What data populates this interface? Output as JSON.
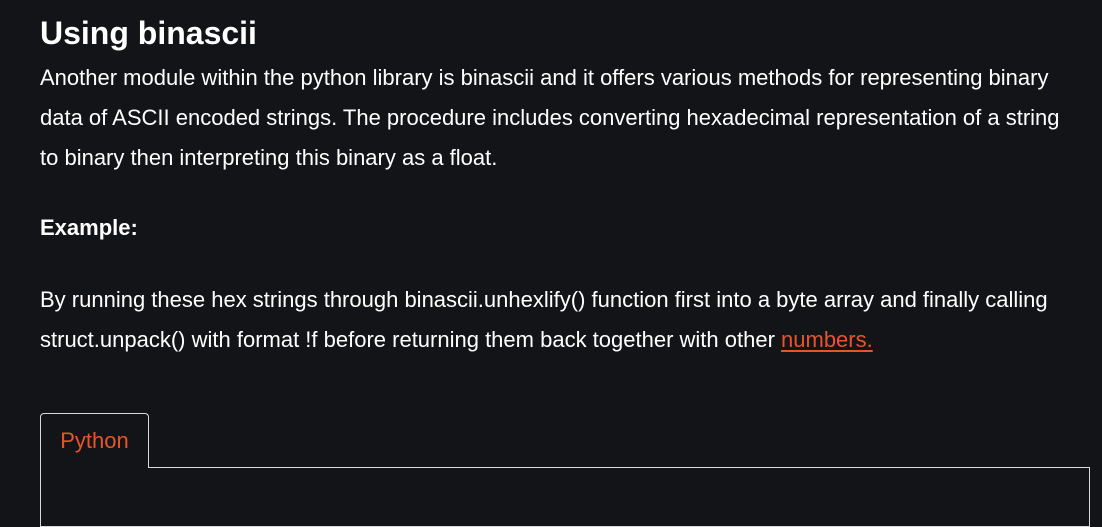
{
  "section": {
    "title": "Using binascii",
    "intro": "Another module within the python library is binascii and it offers various methods for representing binary data of ASCII encoded strings. The procedure includes converting hexadecimal representation of a string to binary then interpreting this binary as a float.",
    "example_label": "Example:",
    "body_text": "By running these hex strings through binascii.unhexlify() function first into a byte array and finally calling struct.unpack() with format !f before returning them back together with other ",
    "link_text": "numbers."
  },
  "code_block": {
    "tabs": [
      {
        "label": "Python"
      }
    ]
  },
  "colors": {
    "background": "#131417",
    "text": "#ffffff",
    "accent": "#e8542a",
    "border": "#d8d8d8"
  }
}
